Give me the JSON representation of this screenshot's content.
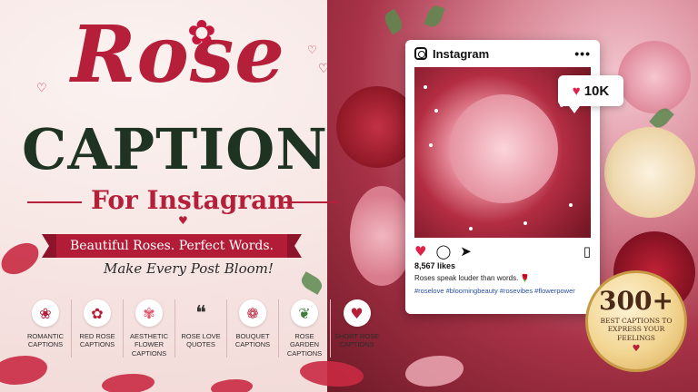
{
  "hero": {
    "title_top": "Rose",
    "title_main": "CAPTION",
    "subtitle": "For Instagram",
    "banner": "Beautiful Roses. Perfect Words.",
    "tagline": "Make Every Post Bloom!"
  },
  "categories": [
    {
      "label": "ROMANTIC CAPTIONS",
      "icon": "rose-outline-icon"
    },
    {
      "label": "RED ROSE CAPTIONS",
      "icon": "red-rose-icon"
    },
    {
      "label": "AESTHETIC FLOWER CAPTIONS",
      "icon": "flower-icon"
    },
    {
      "label": "ROSE LOVE QUOTES",
      "icon": "quote-icon"
    },
    {
      "label": "BOUQUET CAPTIONS",
      "icon": "bouquet-icon"
    },
    {
      "label": "ROSE GARDEN CAPTIONS",
      "icon": "rose-garden-icon"
    },
    {
      "label": "SHORT ROSE CAPTIONS",
      "icon": "heart-icon"
    }
  ],
  "instagram": {
    "app_name": "Instagram",
    "likes_bubble": "10K",
    "likes_count": "8,567 likes",
    "caption": "Roses speak louder than words. 🌹",
    "hashtags": "#roselove #bloomingbeauty #rosevibes #flowerpower"
  },
  "badge": {
    "count": "300+",
    "text": "BEST CAPTIONS TO EXPRESS YOUR FEELINGS"
  },
  "colors": {
    "accent_red": "#b61f3a",
    "dark_green": "#1f3322",
    "gold": "#d9ac57"
  }
}
